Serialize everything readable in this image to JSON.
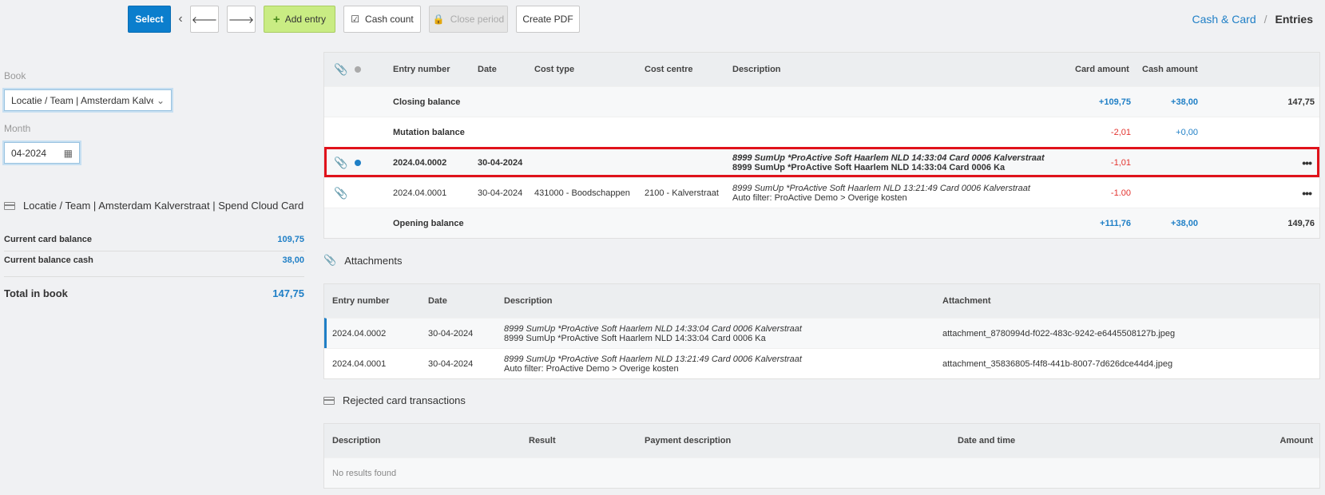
{
  "toolbar": {
    "select_label": "Select",
    "add_entry_label": "Add entry",
    "cash_count_label": "Cash count",
    "close_period_label": "Close period",
    "create_pdf_label": "Create PDF"
  },
  "breadcrumb": {
    "parent": "Cash & Card",
    "separator": "/",
    "current": "Entries"
  },
  "left": {
    "book_label": "Book",
    "book_value": "Locatie / Team | Amsterdam Kalverstraat",
    "month_label": "Month",
    "month_value": "04-2024",
    "book_title": "Locatie / Team | Amsterdam Kalverstraat | Spend Cloud Card",
    "card_balance_label": "Current card balance",
    "card_balance_value": "109,75",
    "cash_balance_label": "Current balance cash",
    "cash_balance_value": "38,00",
    "total_label": "Total in book",
    "total_value": "147,75"
  },
  "entries": {
    "headers": {
      "entry_number": "Entry number",
      "date": "Date",
      "cost_type": "Cost type",
      "cost_centre": "Cost centre",
      "description": "Description",
      "card_amount": "Card amount",
      "cash_amount": "Cash amount"
    },
    "closing": {
      "label": "Closing balance",
      "card": "+109,75",
      "cash": "+38,00",
      "total": "147,75"
    },
    "mutation": {
      "label": "Mutation balance",
      "card": "-2,01",
      "cash": "+0,00"
    },
    "rows": [
      {
        "entry_number": "2024.04.0002",
        "date": "30-04-2024",
        "cost_type": "",
        "cost_centre": "",
        "desc_line1": "8999 SumUp *ProActive Soft Haarlem NLD 14:33:04 Card 0006 Kalverstraat",
        "desc_line2": "8999 SumUp *ProActive Soft Haarlem NLD 14:33:04 Card 0006 Ka",
        "card": "-1,01"
      },
      {
        "entry_number": "2024.04.0001",
        "date": "30-04-2024",
        "cost_type": "431000 - Boodschappen",
        "cost_centre": "2100 - Kalverstraat",
        "desc_line1": "8999 SumUp *ProActive Soft Haarlem NLD 13:21:49 Card 0006 Kalverstraat",
        "desc_line2": "Auto filter: ProActive Demo > Overige kosten",
        "card": "-1.00"
      }
    ],
    "opening": {
      "label": "Opening balance",
      "card": "+111,76",
      "cash": "+38,00",
      "total": "149,76"
    }
  },
  "attachments": {
    "title": "Attachments",
    "headers": {
      "entry_number": "Entry number",
      "date": "Date",
      "description": "Description",
      "attachment": "Attachment"
    },
    "rows": [
      {
        "entry_number": "2024.04.0002",
        "date": "30-04-2024",
        "desc_line1": "8999 SumUp *ProActive Soft Haarlem NLD 14:33:04 Card 0006 Kalverstraat",
        "desc_line2": "8999 SumUp *ProActive Soft Haarlem NLD 14:33:04 Card 0006 Ka",
        "attachment": "attachment_8780994d-f022-483c-9242-e6445508127b.jpeg"
      },
      {
        "entry_number": "2024.04.0001",
        "date": "30-04-2024",
        "desc_line1": "8999 SumUp *ProActive Soft Haarlem NLD 13:21:49 Card 0006 Kalverstraat",
        "desc_line2": "Auto filter: ProActive Demo > Overige kosten",
        "attachment": "attachment_35836805-f4f8-441b-8007-7d626dce44d4.jpeg"
      }
    ]
  },
  "rejected": {
    "title": "Rejected card transactions",
    "headers": {
      "description": "Description",
      "result": "Result",
      "payment_description": "Payment description",
      "date_time": "Date and time",
      "amount": "Amount"
    },
    "empty": "No results found"
  },
  "colors": {
    "accent": "#1f7fc6",
    "select_button": "#0b7ecd",
    "add_button": "#c9ec83",
    "negative": "#e3342f",
    "highlight": "#e0121b"
  }
}
